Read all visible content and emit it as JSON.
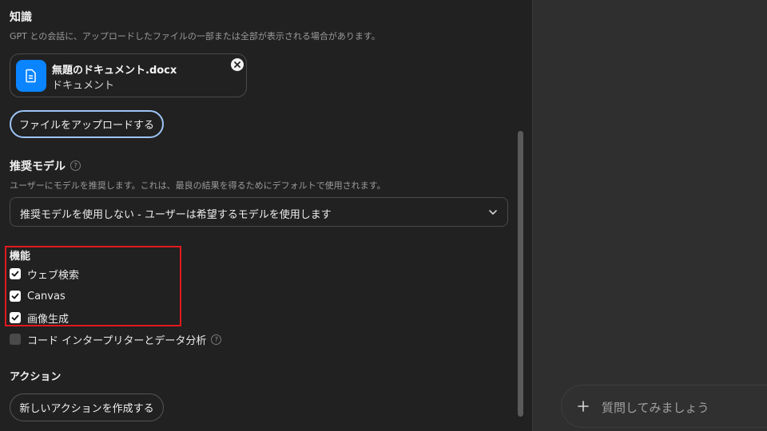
{
  "knowledge": {
    "title": "知識",
    "description": "GPT との会話に、アップロードしたファイルの一部または全部が表示される場合があります。",
    "file": {
      "name": "無題のドキュメント.docx",
      "type": "ドキュメント",
      "icon": "document-icon"
    },
    "upload_label": "ファイルをアップロードする"
  },
  "recommended_model": {
    "title": "推奨モデル",
    "help": "?",
    "description": "ユーザーにモデルを推奨します。これは、最良の結果を得るためにデフォルトで使用されます。",
    "selected": "推奨モデルを使用しない - ユーザーは希望するモデルを使用します"
  },
  "capabilities": {
    "title": "機能",
    "items": [
      {
        "label": "ウェブ検索",
        "checked": true
      },
      {
        "label": "Canvas",
        "checked": true
      },
      {
        "label": "画像生成",
        "checked": true
      },
      {
        "label": "コード インタープリターとデータ分析",
        "checked": false
      }
    ],
    "help": "?"
  },
  "actions": {
    "title": "アクション",
    "create_label": "新しいアクションを作成する"
  },
  "preview": {
    "placeholder": "質問してみましょう"
  },
  "colors": {
    "highlight": "#e0191e",
    "file_icon_bg": "#0a84ff",
    "upload_border": "#9ec5f7"
  }
}
